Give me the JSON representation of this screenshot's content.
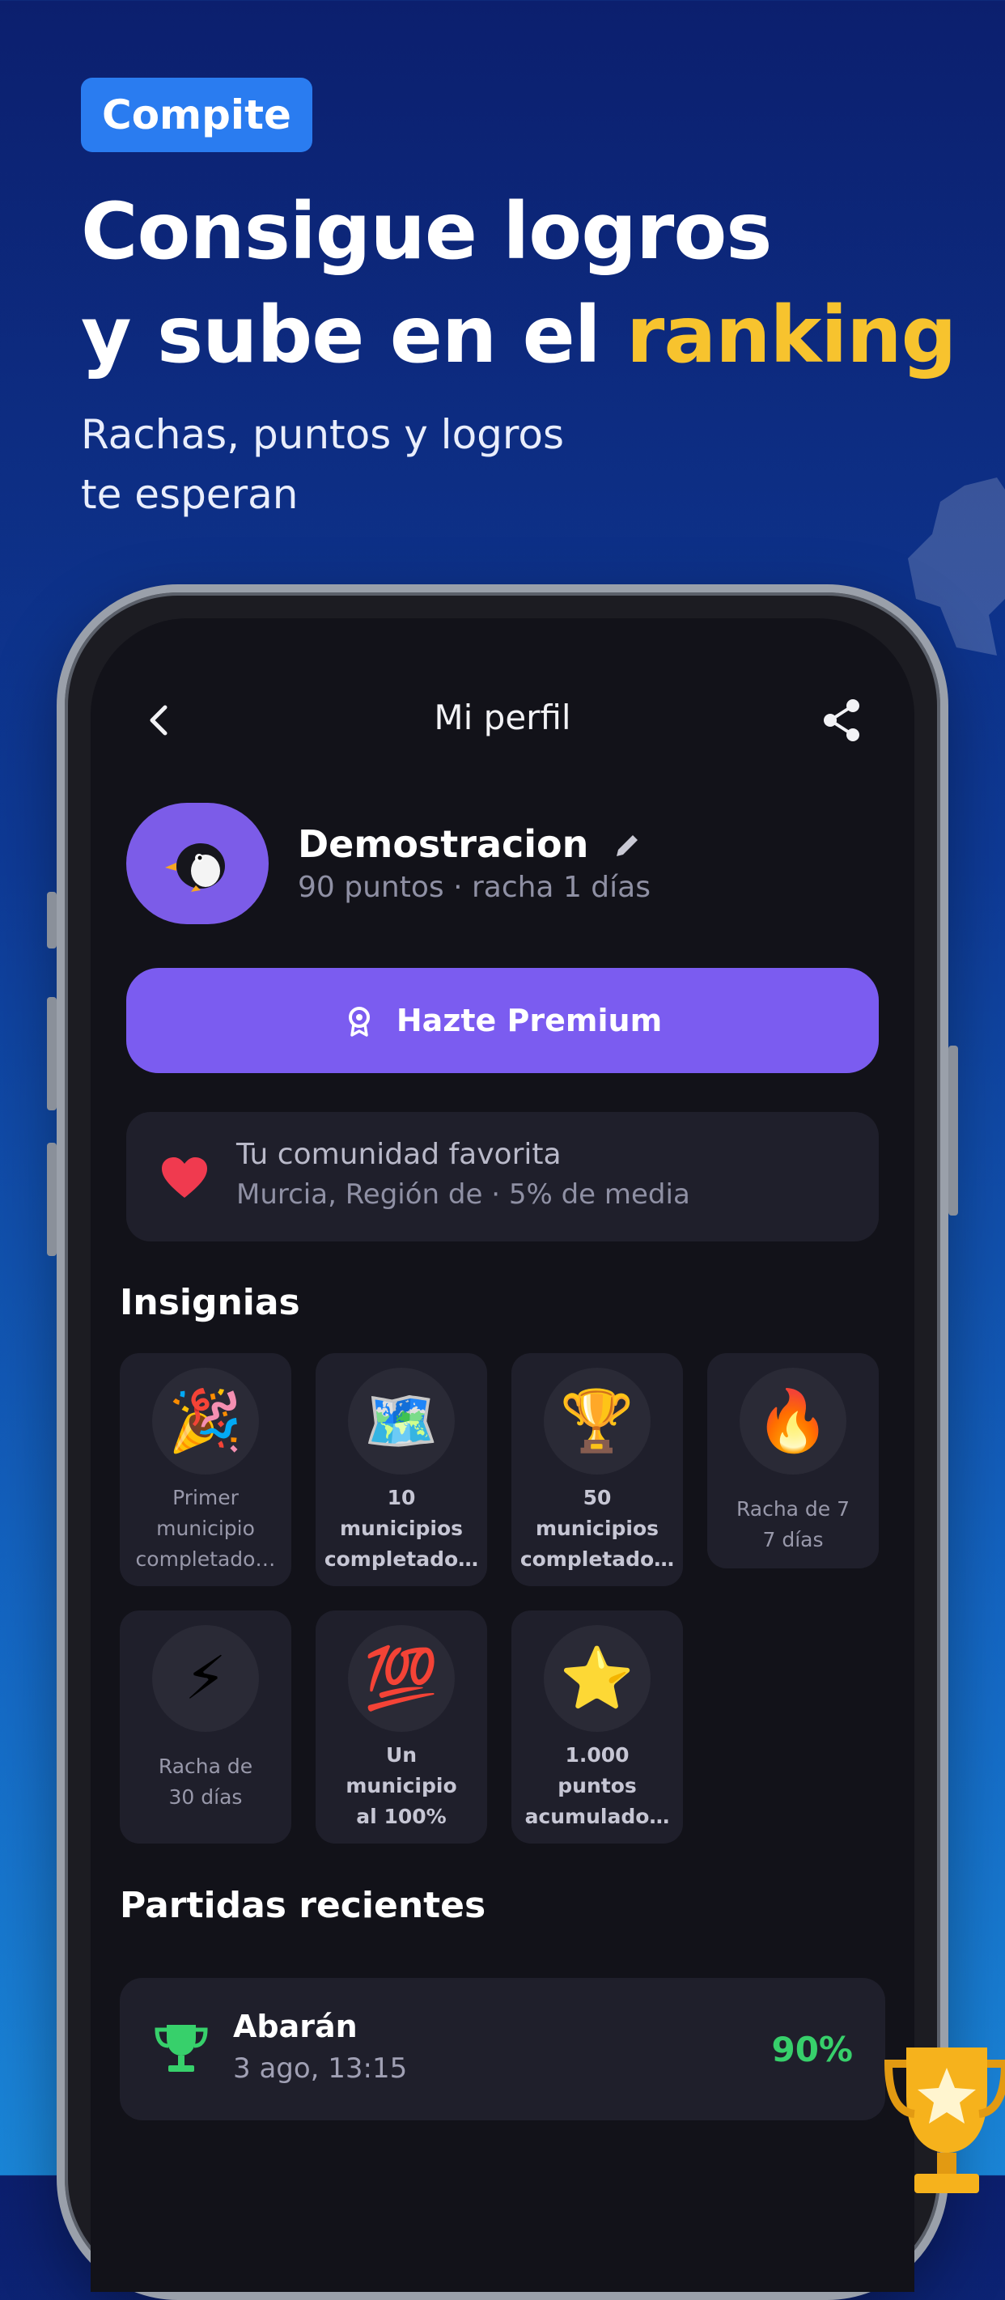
{
  "promo": {
    "tag": "Compite",
    "headline_line1": "Consigue logros",
    "headline_line2_prefix": "y sube en el ",
    "headline_highlight": "ranking",
    "subline_line1": "Rachas, puntos y logros",
    "subline_line2": "te esperan"
  },
  "app": {
    "header": {
      "title": "Mi perfil",
      "back_icon": "chevron-left-icon",
      "share_icon": "share-icon"
    },
    "profile": {
      "avatar": "penguin-avatar",
      "name": "Demostracion",
      "stats": "90 puntos · racha 1 días",
      "edit_icon": "pencil-icon"
    },
    "premium_button": {
      "label": "Hazte Premium",
      "icon": "medal-icon"
    },
    "community": {
      "icon": "heart-icon",
      "title": "Tu comunidad favorita",
      "subtitle": "Murcia, Región de · 5% de media"
    },
    "badges_section": {
      "title": "Insignias",
      "badges": [
        {
          "emoji": "🎉",
          "line1": "Primer",
          "line2": "municipio",
          "line3": "completado…",
          "unlocked": false
        },
        {
          "emoji": "🗺️",
          "line1": "10",
          "line2": "municipios",
          "line3": "completado…",
          "unlocked": true
        },
        {
          "emoji": "🏆",
          "line1": "50",
          "line2": "municipios",
          "line3": "completado…",
          "unlocked": true
        },
        {
          "emoji": "🔥",
          "line1": "Racha de 7",
          "line2": "7 días",
          "line3": "",
          "unlocked": false
        },
        {
          "emoji": "⚡",
          "line1": "Racha de",
          "line2": "30 días",
          "line3": "",
          "unlocked": false
        },
        {
          "emoji": "💯",
          "line1": "Un",
          "line2": "municipio",
          "line3": "al 100%",
          "unlocked": true
        },
        {
          "emoji": "⭐",
          "line1": "1.000",
          "line2": "puntos",
          "line3": "acumulado…",
          "unlocked": true
        }
      ]
    },
    "recent_games": {
      "title": "Partidas recientes",
      "items": [
        {
          "icon": "trophy-icon",
          "place": "Abarán",
          "date": "3 ago, 13:15",
          "score": "90%"
        }
      ]
    }
  },
  "colors": {
    "accent_purple": "#7b5cf0",
    "highlight_yellow": "#f7c32e",
    "score_green": "#37d06b",
    "tag_blue": "#2a7cf0"
  }
}
